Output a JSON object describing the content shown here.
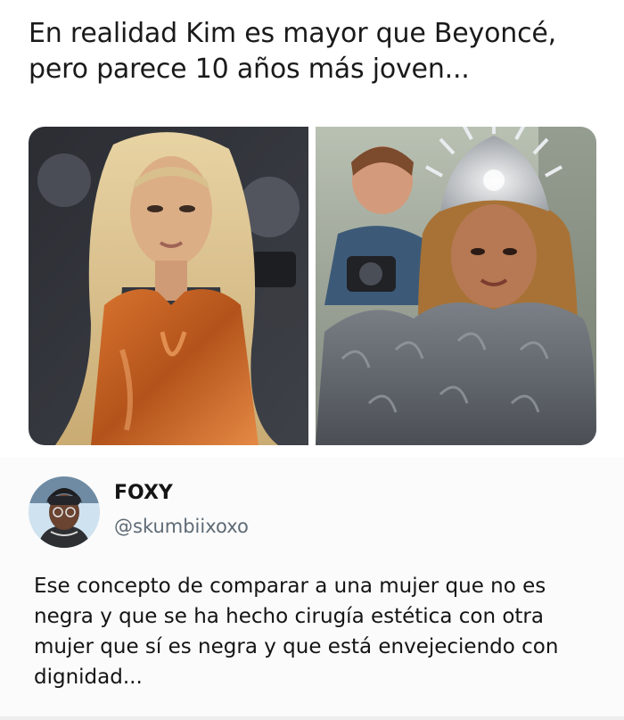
{
  "post": {
    "title_line1": "En realidad Kim es mayor que Beyoncé,",
    "title_line2": "pero parece 10 años más joven..."
  },
  "images": {
    "left_photo": "woman with blonde hair in orange sculpted dress",
    "right_photo": "woman wearing silver crown headpiece and grey feather outfit"
  },
  "tweet": {
    "display_name": "FOXY",
    "handle": "@skumbiixoxo",
    "text_line1": "Ese concepto de comparar a una mujer que no es",
    "text_line2": "negra y que se ha hecho cirugía estética con otra",
    "text_line3": "mujer que sí es negra y que está envejeciendo con",
    "text_line4": "dignidad..."
  },
  "colors": {
    "background": "#ffffff",
    "card_background": "#fbfbfb",
    "handle_gray": "#5e6a74"
  }
}
